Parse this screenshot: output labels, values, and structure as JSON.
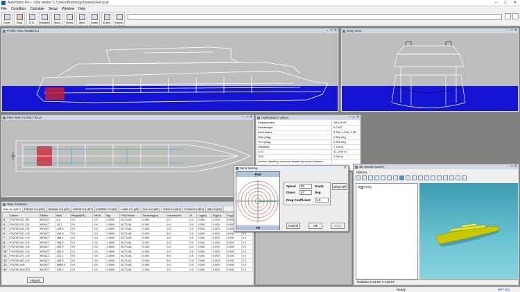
{
  "titlebar": {
    "title": "AutoHydro Pro - Ship Model: C:\\Users\\Boenergy\\Desktop\\Ferry.gf"
  },
  "menu": [
    "File",
    "Condition",
    "Calculate",
    "Setup",
    "Window",
    "Help"
  ],
  "toolbar": [
    "Solve",
    "Stop",
    "R.A.",
    "Weights",
    "Tanks",
    "Fluids",
    "Wind",
    "Drafts",
    "Editor",
    "Report"
  ],
  "profile_view": {
    "title": "Profile View 79.886 ft,4"
  },
  "body_view": {
    "title": "Body View"
  },
  "plan_view": {
    "title": "Plan View 74.808,7.54 yt"
  },
  "hydro": {
    "title": "Hydrostatics Values",
    "rows": [
      [
        "Displacement",
        "2602.5 MT"
      ],
      [
        "Deadweight",
        "0.0 MT"
      ],
      [
        "Draft status",
        "4.75a, 4.59a, 4.38"
      ],
      [
        "Heel (deg)",
        "2.95p deg"
      ],
      [
        "Trim (deg)",
        "0.32a deg"
      ],
      [
        "GM(fluid)",
        "7.148 m"
      ],
      [
        "LCG",
        "31.2729 m"
      ],
      [
        "VCG",
        "0.000 m"
      ],
      [
        "Anchor Handling: moment created by current tension",
        ""
      ],
      [
        "Max% B.M. Loc",
        "0.00"
      ]
    ]
  },
  "wind": {
    "title": "Wind Setting",
    "fwd": "Fwd",
    "aft": "Aft",
    "speed_label": "Speed",
    "speed": "50",
    "speed_unit": "Knots",
    "direct_label": "Direct",
    "direct": "67",
    "direct_unit": "Deg",
    "drag_label": "Drag Coefficient",
    "drag": "1.2",
    "wind_off": "Wind Off",
    "cancel": "Cancel",
    "ok": "Ok",
    "apply": "Apply"
  },
  "view3d": {
    "title": "3D Vessel Control",
    "options": "Options",
    "tree_item": "Ferry",
    "rotation": "Rotation X:14.69 Y:-125.67"
  },
  "tanks": {
    "title": "Tank Contents",
    "groups": [
      "BAL 61.4(MT)",
      "FRESH 0.0 (MT)",
      "SEWAG 0.0 (MT)",
      "DIESE 0.0 (MT)",
      "HYDRO 0.0 (MT)",
      "LUBE 0.0 (MT)",
      "SLU 0.0 (MT)",
      "VOID 0.0 (MT)",
      "FOAM 0.0 (MT)",
      "AB 0.0 (MT)"
    ],
    "columns": [
      "",
      "Name",
      "Status",
      "Max",
      "Weight(MT)",
      "%Full",
      "Sgr",
      "FSM Mode",
      "Sounding(m)",
      "Volume(m³)",
      "%",
      "Lcg(m)",
      "Tcg(m)",
      "Vcg(m)",
      "FWS"
    ],
    "rows": [
      [
        "3",
        "RVOID102_SB",
        "INTACT",
        "8.4",
        "0.0",
        "0.0",
        "1.0000",
        "ACTUAL",
        "0.000",
        "0.0",
        "0.0",
        "0.000",
        "0.000",
        "0.000",
        "0.0"
      ],
      [
        "4",
        "RVOID110_CN",
        "INTACT",
        "14.7",
        "0.0",
        "0.0",
        "1.0000",
        "ACTUAL",
        "0.000",
        "0.0",
        "0.0",
        "0.000",
        "0.000",
        "0.000",
        "0.0"
      ],
      [
        "5",
        "RVOID116_CN",
        "INTACT",
        "128.6",
        "0.0",
        "0.0",
        "1.0000",
        "ACTUAL",
        "0.000",
        "0.0",
        "0.0",
        "0.000",
        "0.000",
        "0.000",
        "0.0"
      ],
      [
        "6",
        "RVOID120_CN",
        "INTACT",
        "136.8",
        "0.0",
        "0.0",
        "1.0000",
        "ACTUAL",
        "0.000",
        "0.0",
        "0.0",
        "0.000",
        "0.000",
        "0.000",
        "0.0"
      ],
      [
        "7",
        "RVOID130_CN",
        "INTACT",
        "168.4",
        "0.0",
        "0.0",
        "1.0000",
        "ACTUAL",
        "0.000",
        "0.0",
        "0.0",
        "0.000",
        "0.000",
        "0.000",
        "0.0"
      ],
      [
        "8",
        "RVOID140_CN",
        "INTACT",
        "138.3",
        "0.0",
        "0.0",
        "1.0000",
        "ACTUAL",
        "0.000",
        "0.0",
        "0.0",
        "0.000",
        "0.000",
        "0.000",
        "0.0"
      ],
      [
        "9",
        "RVOID150_CN",
        "INTACT",
        "340.3",
        "0.0",
        "0.0",
        "1.0000",
        "ACTUAL",
        "0.000",
        "0.0",
        "0.0",
        "0.000",
        "0.000",
        "0.000",
        "0.0"
      ],
      [
        "10",
        "RVOID160_CN",
        "INTACT",
        "282.6",
        "0.0",
        "0.0",
        "1.0000",
        "ACTUAL",
        "0.000",
        "0.0",
        "0.0",
        "0.000",
        "0.000",
        "0.000",
        "0.0"
      ],
      [
        "11",
        "RVOID170_CN",
        "INTACT",
        "142.2",
        "0.0",
        "0.0",
        "1.0000",
        "ACTUAL",
        "0.000",
        "0.0",
        "0.0",
        "0.000",
        "0.000",
        "0.000",
        "0.0"
      ],
      [
        "12",
        "RVOID180_CN",
        "INTACT",
        "169.5",
        "0.0",
        "0.0",
        "1.0000",
        "ACTUAL",
        "0.000",
        "0.0",
        "0.0",
        "0.000",
        "0.000",
        "0.000",
        "0.0"
      ],
      [
        "13",
        "RVOID.000",
        "INTACT",
        "3898.9",
        "0.0",
        "0.0",
        "1.0000",
        "ACTUAL",
        "0.000",
        "0.0",
        "0.0",
        "0.000",
        "0.000",
        "0.000",
        "0.0"
      ],
      [
        "14",
        "RVOID.000_PS",
        "INTACT",
        "234.2",
        "0.0",
        "0.0",
        "1.0000",
        "ACTUAL",
        "0.000",
        "0.0",
        "0.0",
        "0.000",
        "0.000",
        "0.000",
        "0.0"
      ]
    ],
    "report": "Report"
  },
  "status": {
    "ready": "Ready",
    "rpt": "RPT ON"
  },
  "colors": {
    "water": "#1414d2",
    "canvas": "#bdbdbd",
    "wireframe": "#ffffff",
    "sea3d": "#5fb6c6",
    "ship3d": "#d6d600"
  }
}
